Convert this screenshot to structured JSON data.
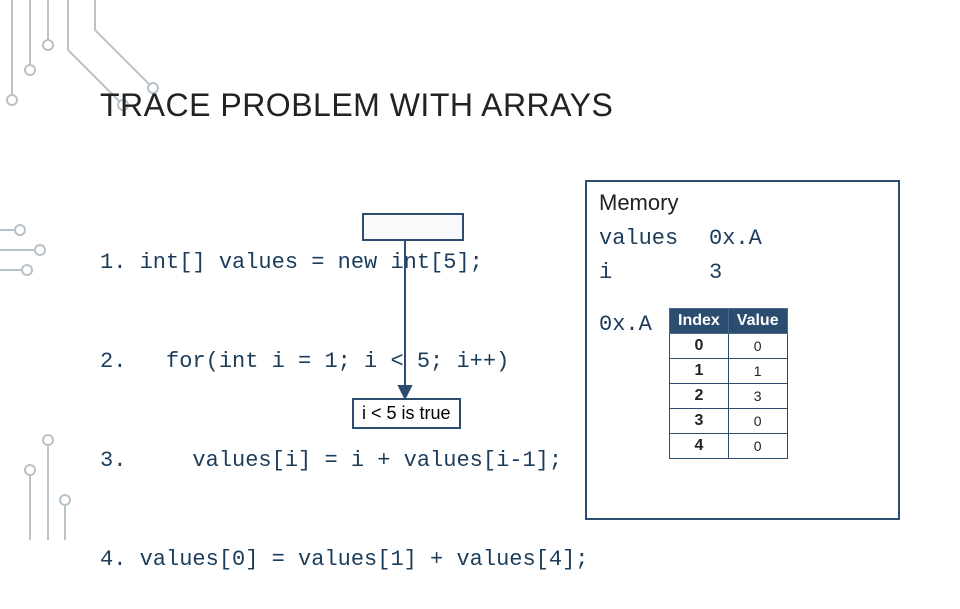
{
  "title": "TRACE PROBLEM WITH ARRAYS",
  "code": {
    "lines": [
      {
        "n": "1.",
        "t": "int[] values = new int[5];"
      },
      {
        "n": "2.",
        "t": "  for(int i = 1; i < 5; i++)"
      },
      {
        "n": "3.",
        "t": "    values[i] = i + values[i-1];"
      },
      {
        "n": "4.",
        "t": "values[0] = values[1] + values[4];"
      }
    ],
    "highlight_fragment": "i < 5;"
  },
  "callout": "i < 5 is true",
  "memory": {
    "heading": "Memory",
    "vars": [
      {
        "name": "values",
        "val": "0x.A"
      },
      {
        "name": "i",
        "val": "3"
      }
    ],
    "array": {
      "addr": "0x.A",
      "headers": [
        "Index",
        "Value"
      ],
      "rows": [
        {
          "idx": "0",
          "val": "0"
        },
        {
          "idx": "1",
          "val": "1"
        },
        {
          "idx": "2",
          "val": "3"
        },
        {
          "idx": "3",
          "val": "0"
        },
        {
          "idx": "4",
          "val": "0"
        }
      ]
    }
  }
}
